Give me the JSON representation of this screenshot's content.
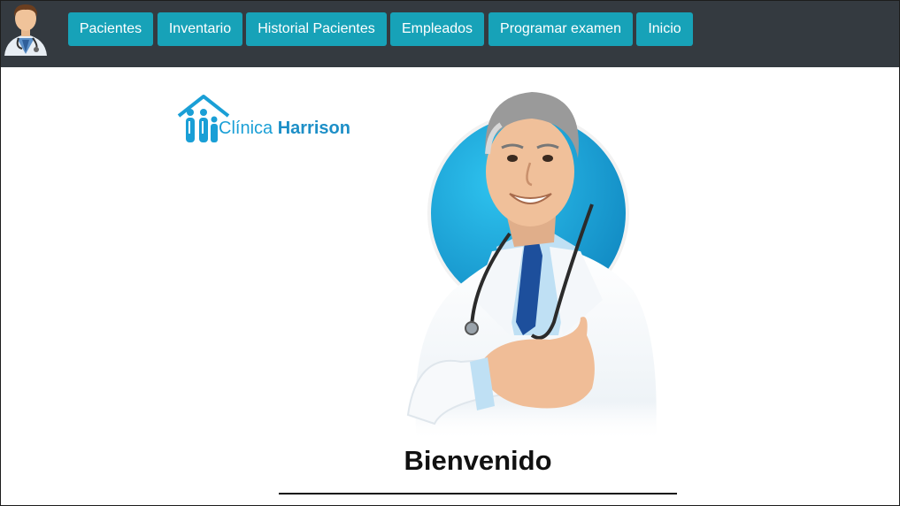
{
  "navbar": {
    "avatar_icon": "doctor-avatar-icon",
    "background": "#343a40",
    "button_color": "#17a2b8",
    "items": [
      {
        "label": "Pacientes"
      },
      {
        "label": "Inventario"
      },
      {
        "label": "Historial Pacientes"
      },
      {
        "label": "Empleados"
      },
      {
        "label": "Programar examen"
      },
      {
        "label": "Inicio"
      }
    ]
  },
  "logo": {
    "icon": "clinic-house-family-icon",
    "word_light": "Clínica",
    "word_bold": "Harrison",
    "color": "#1a9fd6"
  },
  "hero": {
    "image": "smiling-doctor-with-stethoscope",
    "circle_color": "#1fa8d9"
  },
  "main": {
    "welcome": "Bienvenido"
  }
}
